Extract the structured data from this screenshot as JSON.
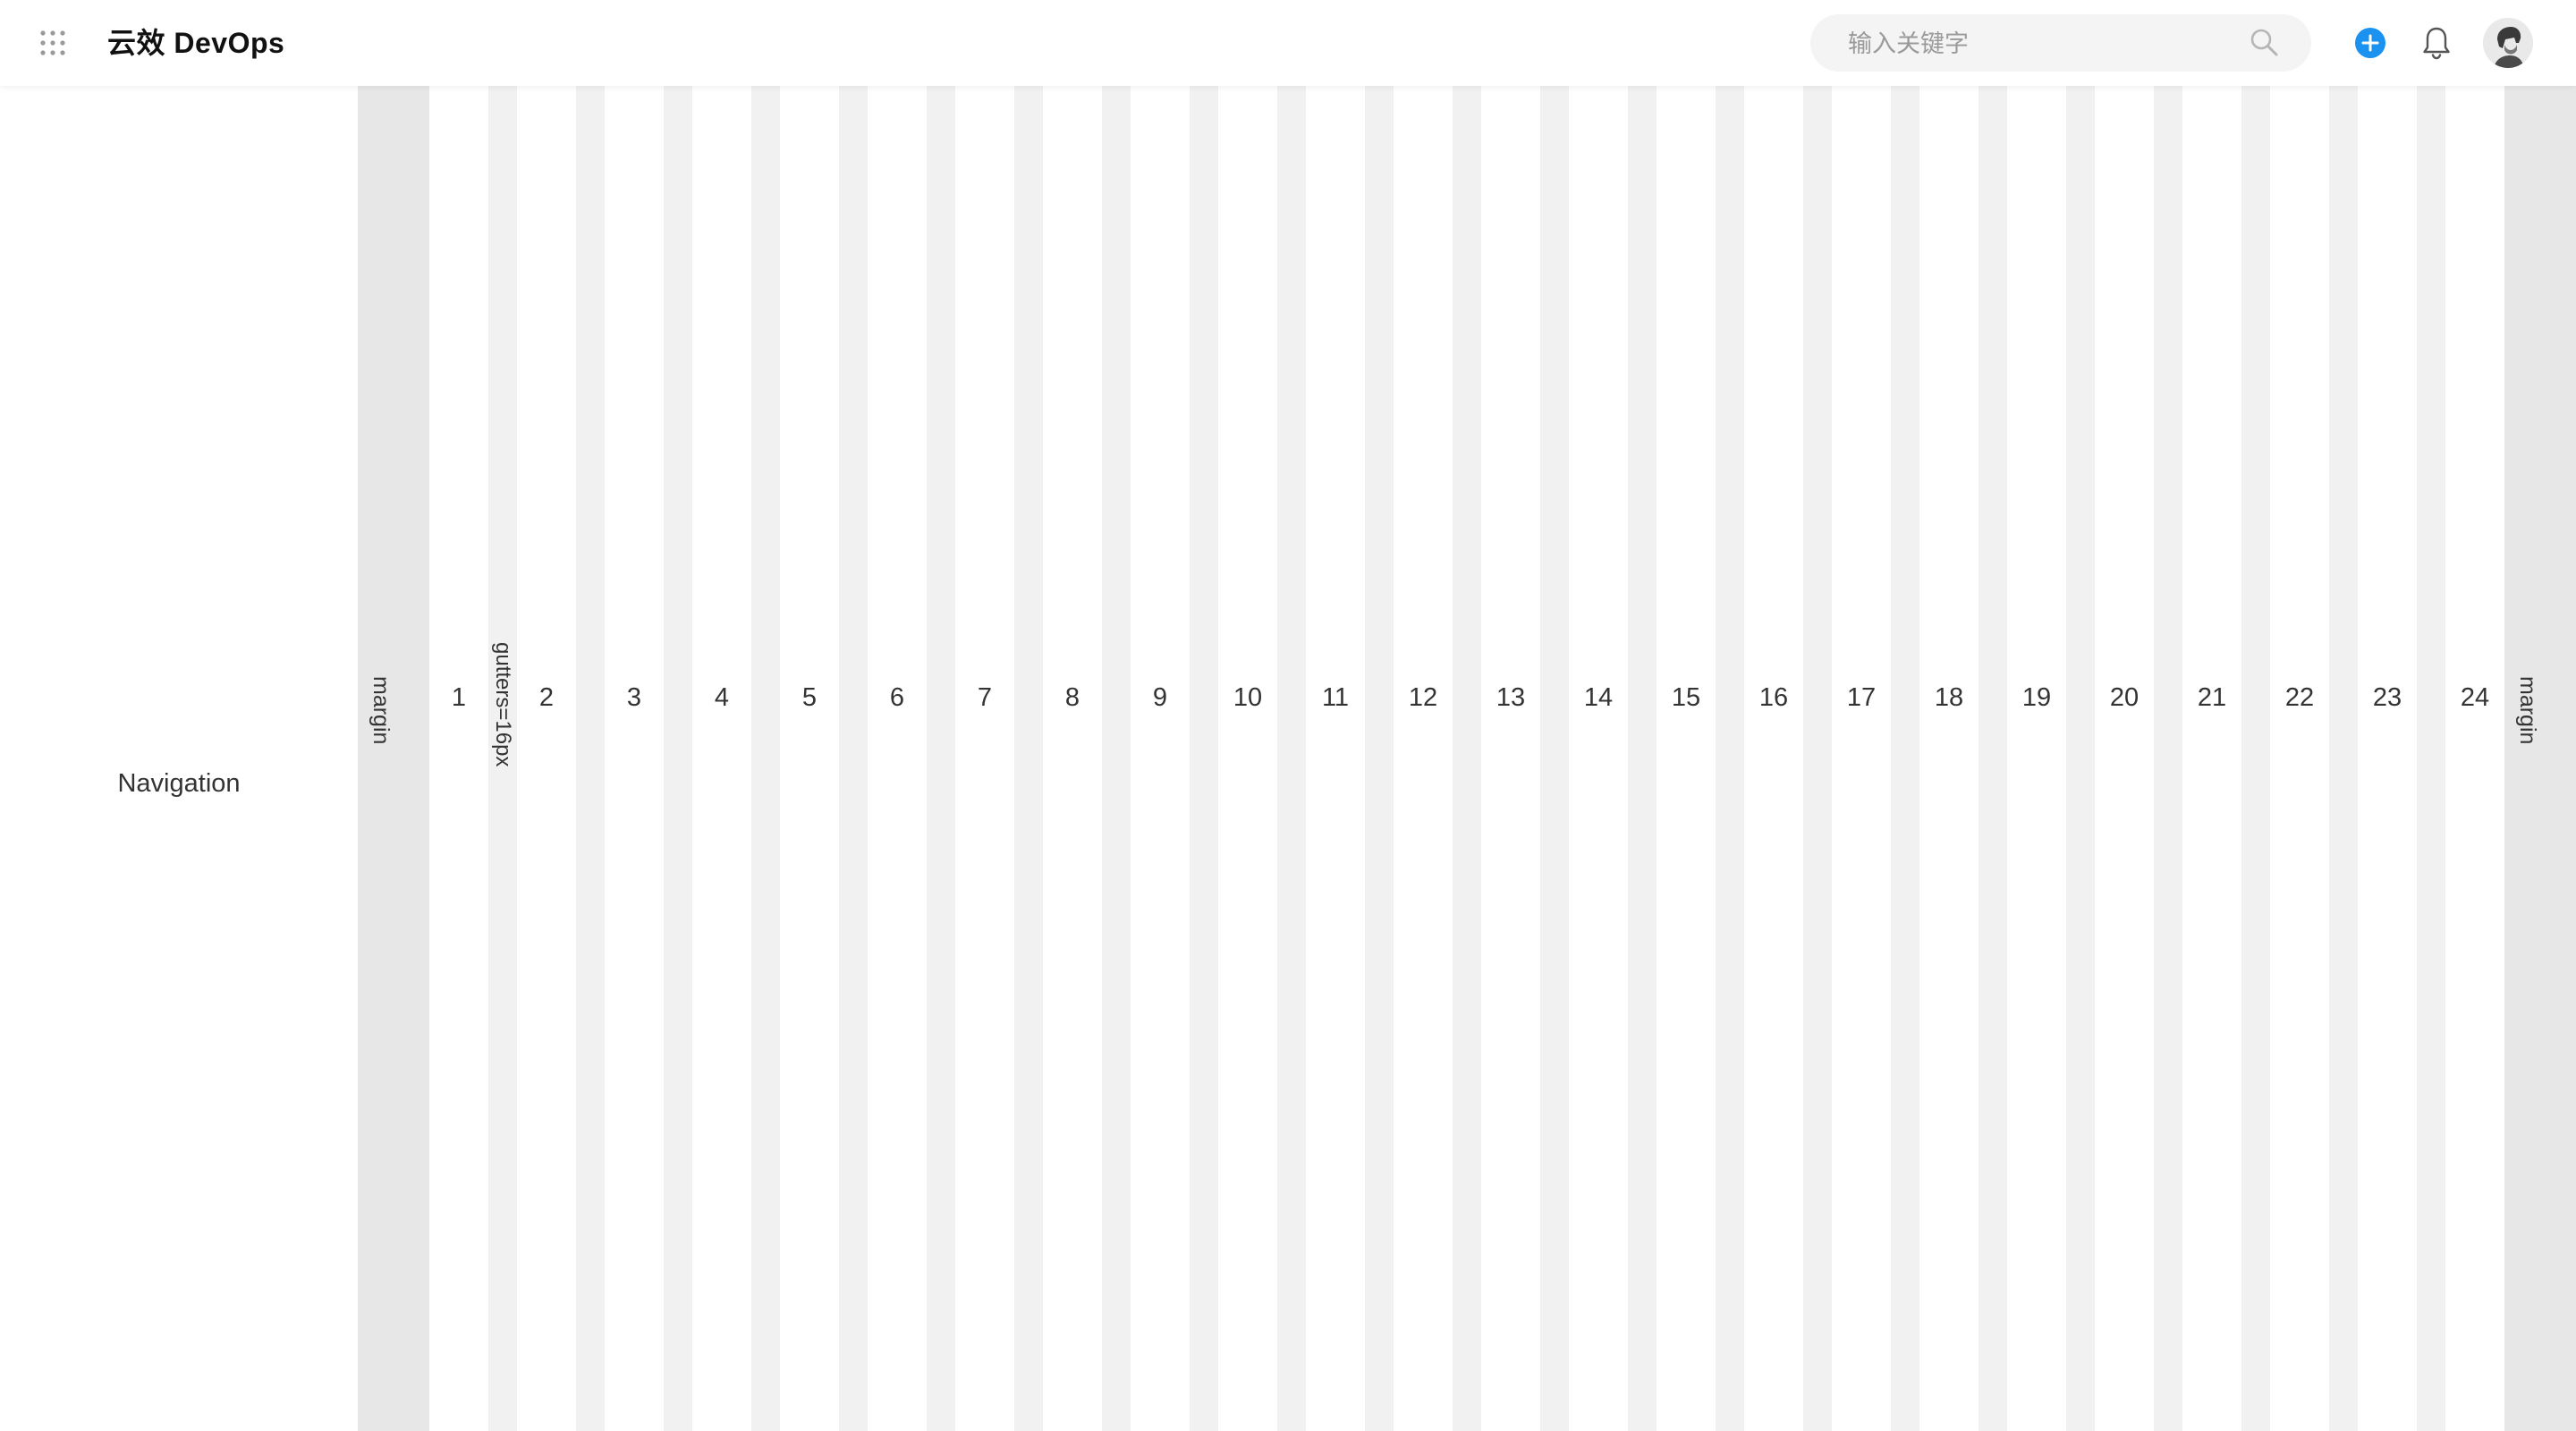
{
  "header": {
    "brand": "云效 DevOps",
    "search": {
      "placeholder": "输入关键字",
      "value": ""
    },
    "icons": [
      "apps-grid-icon",
      "search-icon",
      "add-circle-icon",
      "bell-icon",
      "avatar"
    ],
    "accent_color": "#1B91F0"
  },
  "navigation": {
    "label": "Navigation"
  },
  "grid": {
    "margin_label": "margin",
    "gutter_label": "gutters=16px",
    "columns": [
      "1",
      "2",
      "3",
      "4",
      "5",
      "6",
      "7",
      "8",
      "9",
      "10",
      "11",
      "12",
      "13",
      "14",
      "15",
      "16",
      "17",
      "18",
      "19",
      "20",
      "21",
      "22",
      "23",
      "24"
    ],
    "colors": {
      "margin": "#E7E7E7",
      "gutter": "#F1F1F1",
      "column": "#FFFFFF"
    }
  }
}
